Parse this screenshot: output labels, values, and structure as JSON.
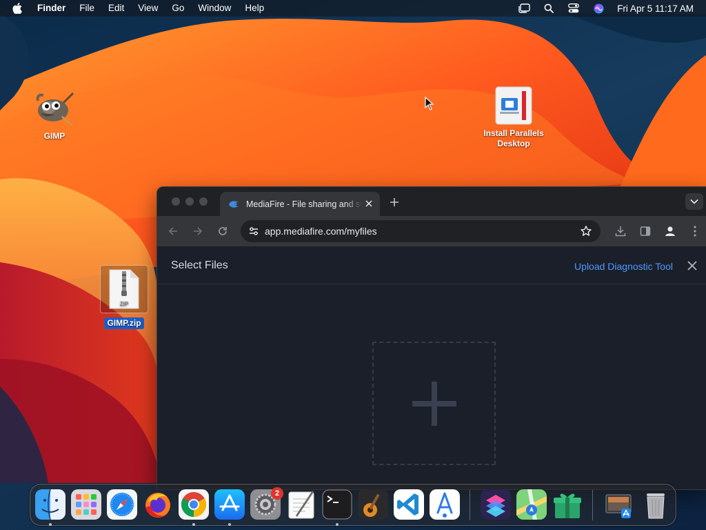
{
  "menubar": {
    "app_name": "Finder",
    "menus": [
      "File",
      "Edit",
      "View",
      "Go",
      "Window",
      "Help"
    ],
    "clock": "Fri Apr 5  11:17 AM"
  },
  "desktop": {
    "icons": [
      {
        "label": "GIMP"
      },
      {
        "label": "Install Parallels Desktop"
      },
      {
        "label": "GIMP.zip",
        "selected": true,
        "file_badge": "ZIP"
      }
    ]
  },
  "browser": {
    "tab_title": "MediaFire - File sharing and storage",
    "url": "app.mediafire.com/myfiles",
    "page": {
      "title": "Select Files",
      "diagnostic_link": "Upload Diagnostic Tool"
    }
  },
  "dock": {
    "items": [
      "Finder",
      "Launchpad",
      "Safari",
      "Firefox",
      "Google Chrome",
      "App Store",
      "System Settings",
      "TextEdit",
      "Terminal",
      "GarageBand",
      "Visual Studio Code",
      "Instruments",
      "Shortcuts",
      "Maps",
      "Gift",
      "Preview",
      "Trash"
    ],
    "system_settings_badge": "2"
  },
  "colors": {
    "link": "#4d9bff",
    "selection": "#1f5fc7",
    "badge": "#e0342b"
  }
}
